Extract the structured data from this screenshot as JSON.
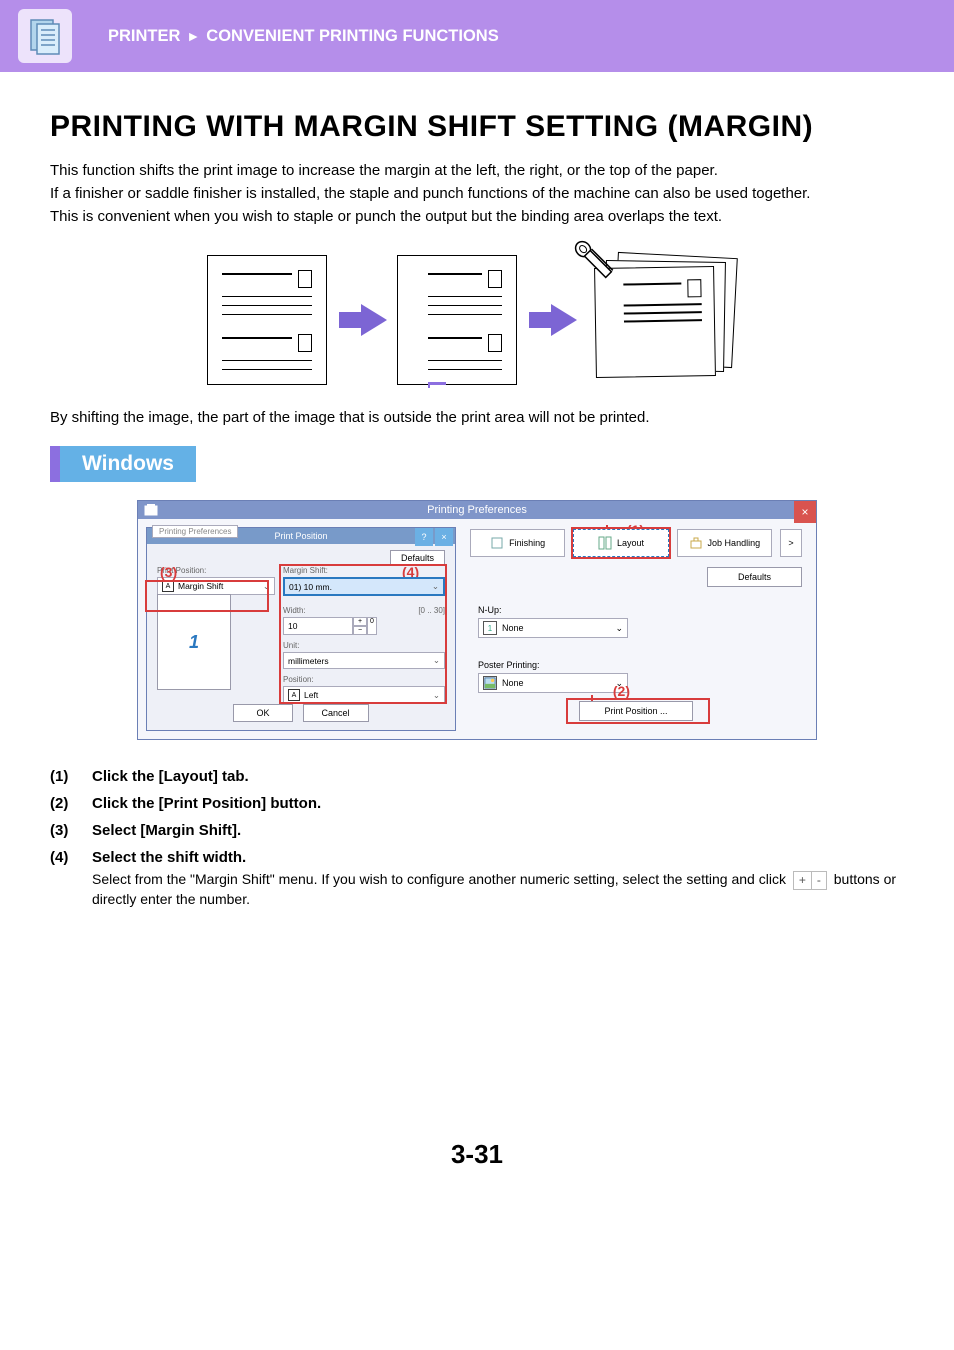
{
  "header": {
    "breadcrumb1": "PRINTER",
    "breadcrumb2": "CONVENIENT PRINTING FUNCTIONS"
  },
  "title": "PRINTING WITH MARGIN SHIFT SETTING (MARGIN)",
  "intro": {
    "p1": "This function shifts the print image to increase the margin at the left, the right, or the top of the paper.",
    "p2": "If a finisher or saddle finisher is installed, the staple and punch functions of the machine can also be used together.",
    "p3": "This is convenient when you wish to staple or punch the output but the binding area overlaps the text."
  },
  "after_diagram": "By shifting the image, the part of the image that is outside the print area will not be printed.",
  "os_badge": "Windows",
  "pref": {
    "window_title": "Printing Preferences",
    "faux_tab": "Printing Preferences",
    "dialog_title": "Print Position",
    "defaults_btn": "Defaults",
    "callouts": {
      "c1": "(1)",
      "c2": "(2)",
      "c3": "(3)",
      "c4": "(4)"
    },
    "left": {
      "print_position_label": "Print Position:",
      "print_position_value": "Margin Shift",
      "margin_shift_label": "Margin Shift:",
      "margin_shift_value": "01) 10 mm.",
      "width_label": "Width:",
      "width_range": "[0 .. 30]",
      "width_value": "10",
      "unit_label": "Unit:",
      "unit_value": "millimeters",
      "position_label": "Position:",
      "position_value": "Left",
      "preview_num": "1",
      "ok": "OK",
      "cancel": "Cancel"
    },
    "right": {
      "tab_finishing": "Finishing",
      "tab_layout": "Layout",
      "tab_job": "Job Handling",
      "tab_next": ">",
      "defaults_btn": "Defaults",
      "nup_label": "N-Up:",
      "nup_value": "None",
      "poster_label": "Poster Printing:",
      "poster_value": "None",
      "print_position_btn": "Print Position ..."
    }
  },
  "steps": {
    "s1": {
      "num": "(1)",
      "text": "Click the [Layout] tab."
    },
    "s2": {
      "num": "(2)",
      "text": "Click the [Print Position] button."
    },
    "s3": {
      "num": "(3)",
      "text": "Select [Margin Shift]."
    },
    "s4": {
      "num": "(4)",
      "text": "Select the shift width.",
      "sub_before": "Select from the \"Margin Shift\" menu. If you wish to configure another numeric setting, select the setting and click ",
      "sub_after": " buttons or directly enter the number."
    }
  },
  "page_number": "3-31",
  "spinner": {
    "plus": "+",
    "minus": "-"
  }
}
